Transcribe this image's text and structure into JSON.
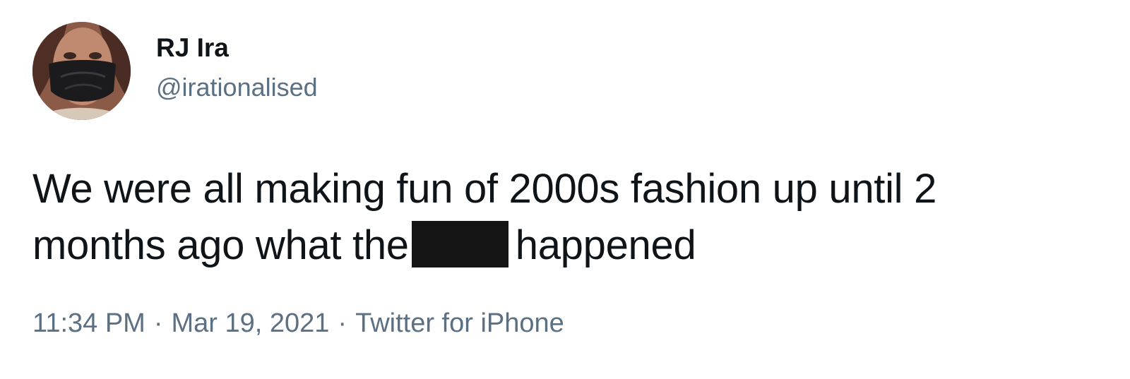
{
  "tweet": {
    "author": {
      "name": "RJ Ira",
      "handle": "@irationalised",
      "avatar": "profile-photo"
    },
    "text": {
      "line1": "We were all making fun of 2000s fashion up until 2",
      "line2_before": "months ago what the",
      "redacted": "redacted-word",
      "line2_after": "happened"
    },
    "meta": {
      "time": "11:34 PM",
      "date": "Mar 19, 2021",
      "source": "Twitter for iPhone",
      "separator": "·"
    },
    "colors": {
      "text": "#0f1419",
      "secondary": "#5b7083",
      "redaction": "#141414"
    }
  }
}
